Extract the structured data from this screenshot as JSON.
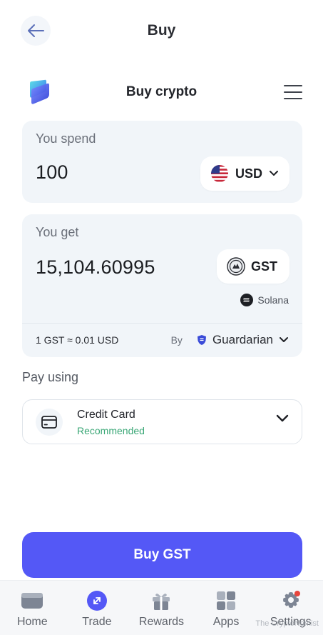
{
  "header": {
    "title": "Buy"
  },
  "widget": {
    "title": "Buy crypto"
  },
  "spend": {
    "label": "You spend",
    "amount": "100",
    "currency": "USD"
  },
  "get": {
    "label": "You get",
    "amount": "15,104.60995",
    "token": "GST",
    "network": "Solana",
    "rate": "1 GST ≈ 0.01 USD",
    "by_label": "By",
    "provider": "Guardarian"
  },
  "payment": {
    "section_label": "Pay using",
    "method": "Credit Card",
    "badge": "Recommended"
  },
  "cta": {
    "label": "Buy GST"
  },
  "nav": {
    "items": [
      {
        "label": "Home",
        "icon": "wallet-icon"
      },
      {
        "label": "Trade",
        "icon": "swap-icon"
      },
      {
        "label": "Rewards",
        "icon": "gift-icon"
      },
      {
        "label": "Apps",
        "icon": "grid-icon"
      },
      {
        "label": "Settings",
        "icon": "gear-icon"
      }
    ]
  },
  "watermark": "The CryptoNomist",
  "colors": {
    "primary": "#5458f6",
    "recommended": "#3aa776",
    "card_bg": "#f1f5f9"
  }
}
